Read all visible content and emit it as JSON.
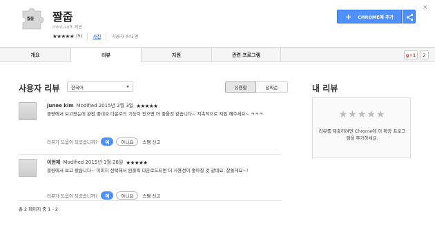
{
  "extension": {
    "icon_label": "짤줍",
    "title": "짤줍",
    "provider": "mint-soft 제공",
    "rating_stars": "★★★★★",
    "rating_count": "(5)",
    "rating_value": 5,
    "category_link": "사진",
    "users": "사용자 441명",
    "add_button": "CHROME에 추가",
    "close_glyph": "×"
  },
  "tabs": [
    {
      "label": "개요",
      "active": false
    },
    {
      "label": "리뷰",
      "active": true
    },
    {
      "label": "지원",
      "active": false
    },
    {
      "label": "관련 프로그램",
      "active": false
    }
  ],
  "social": {
    "gplus_label": "g+1",
    "gplus_count": "2"
  },
  "reviews_section": {
    "title": "사용자 리뷰",
    "language": "한국어",
    "sort_options": [
      {
        "label": "유용함",
        "selected": true
      },
      {
        "label": "날짜순",
        "selected": false
      }
    ]
  },
  "reviews": [
    {
      "author": "junee kim",
      "date": "Modified 2015년 2월 3일",
      "stars": "★★★★★",
      "rating": 5,
      "text": "클량에서 보고왔는데 완전 좋네요 다운로드 기능이 있으면 더 좋을것 같습니다~ 지속적으로 지원 해주세요~ ㅋㅋㅋ",
      "helpful_prompt": "리뷰가 도움이 되셨습니까?",
      "yes": "예",
      "no": "아니요",
      "spam": "스팸 신고"
    },
    {
      "author": "이현제",
      "date": "Modified 2015년 1월 28일",
      "stars": "★★★★★",
      "rating": 5,
      "text": "클량에서 보고 왔습니다~ 이미지 선택해서 원클릭 다운로드되면 더 사용성이 좋아질 것 같네요. 잘쓸게요~!",
      "helpful_prompt": "리뷰가 도움이 되셨습니까?",
      "yes": "예",
      "no": "아니요",
      "spam": "스팸 신고"
    }
  ],
  "pagination": "총 2 페이지 중 1 - 2",
  "my_review": {
    "title": "내 리뷰",
    "stars": "★★★★★",
    "text": "리뷰를 제출하려면 Chrome에 이 확장 프로그램을 추가하세요."
  },
  "colors": {
    "accent": "#4d90fe",
    "gplus": "#d73d32"
  },
  "icons": [
    "puzzle-icon",
    "plus-icon",
    "share-icon",
    "close-icon",
    "chevron-down-icon",
    "avatar-icon"
  ]
}
